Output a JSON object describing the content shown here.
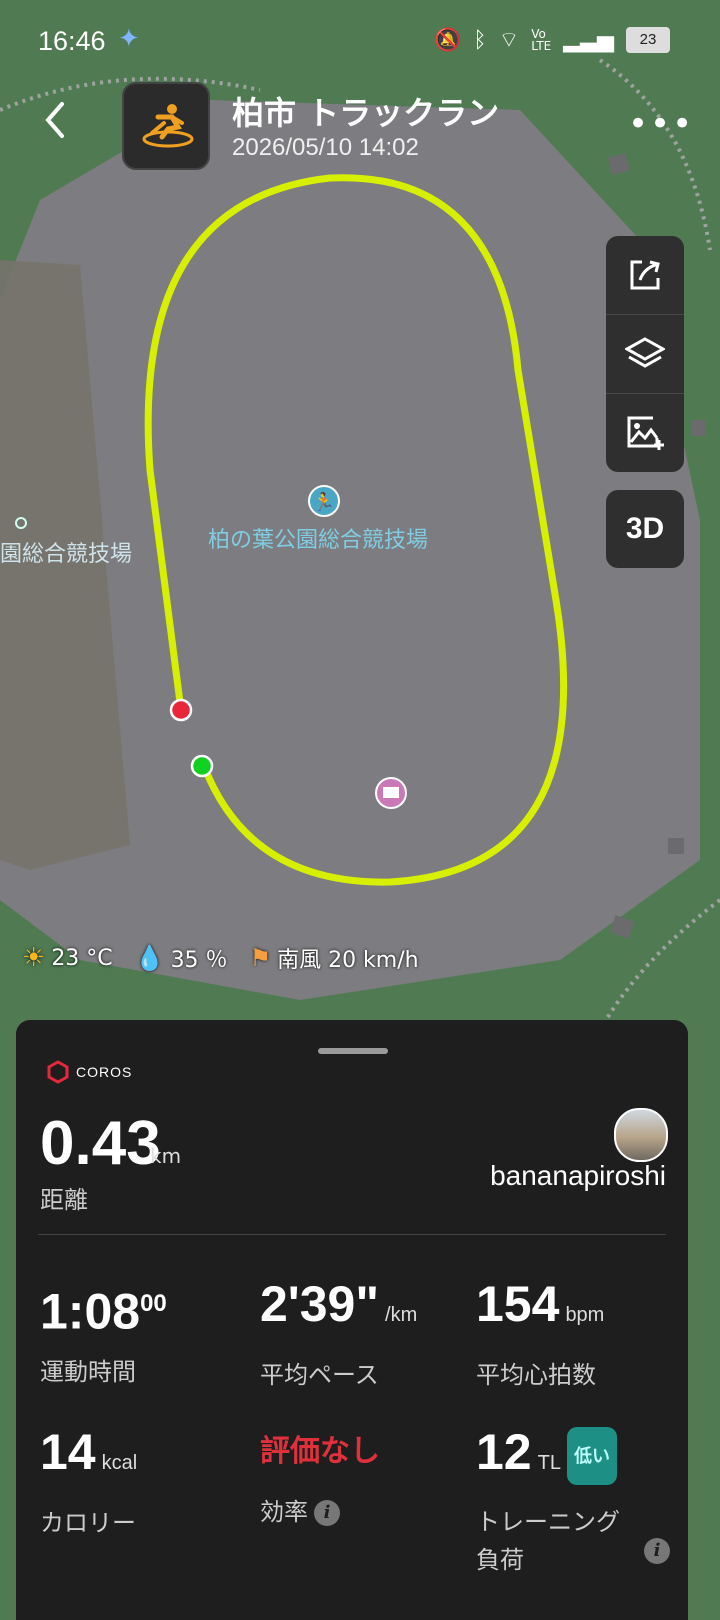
{
  "status": {
    "time": "16:46",
    "battery": "23"
  },
  "header": {
    "title": "柏市 トラックラン",
    "datetime": "2026/05/10 14:02"
  },
  "map": {
    "place_label_main": "柏の葉公園総合競技場",
    "place_label_side": "園総合競技場",
    "controls_3d": "3D"
  },
  "weather": {
    "temperature": "23 °C",
    "humidity": "35 ％",
    "wind": "南風 20 km/h"
  },
  "summary": {
    "brand": "COROS",
    "distance_value": "0.43",
    "distance_unit": "km",
    "distance_label": "距離",
    "username": "bananapiroshi"
  },
  "stats": {
    "duration_main": "1:08",
    "duration_sup": "00",
    "duration_label": "運動時間",
    "pace_value": "2'39\"",
    "pace_unit": "/km",
    "pace_label": "平均ペース",
    "hr_value": "154",
    "hr_unit": "bpm",
    "hr_label": "平均心拍数",
    "calories_value": "14",
    "calories_unit": "kcal",
    "calories_label": "カロリー",
    "efficiency_value": "評価なし",
    "efficiency_label": "効率",
    "training_load_value": "12",
    "training_load_unit": "TL",
    "training_load_badge": "低い",
    "training_load_label": "トレーニング負荷"
  },
  "colors": {
    "route": "#d6f000",
    "start_marker": "#10d020",
    "end_marker": "#e8283a",
    "eval_red": "#e0303c",
    "badge_teal": "#1d8f84"
  }
}
